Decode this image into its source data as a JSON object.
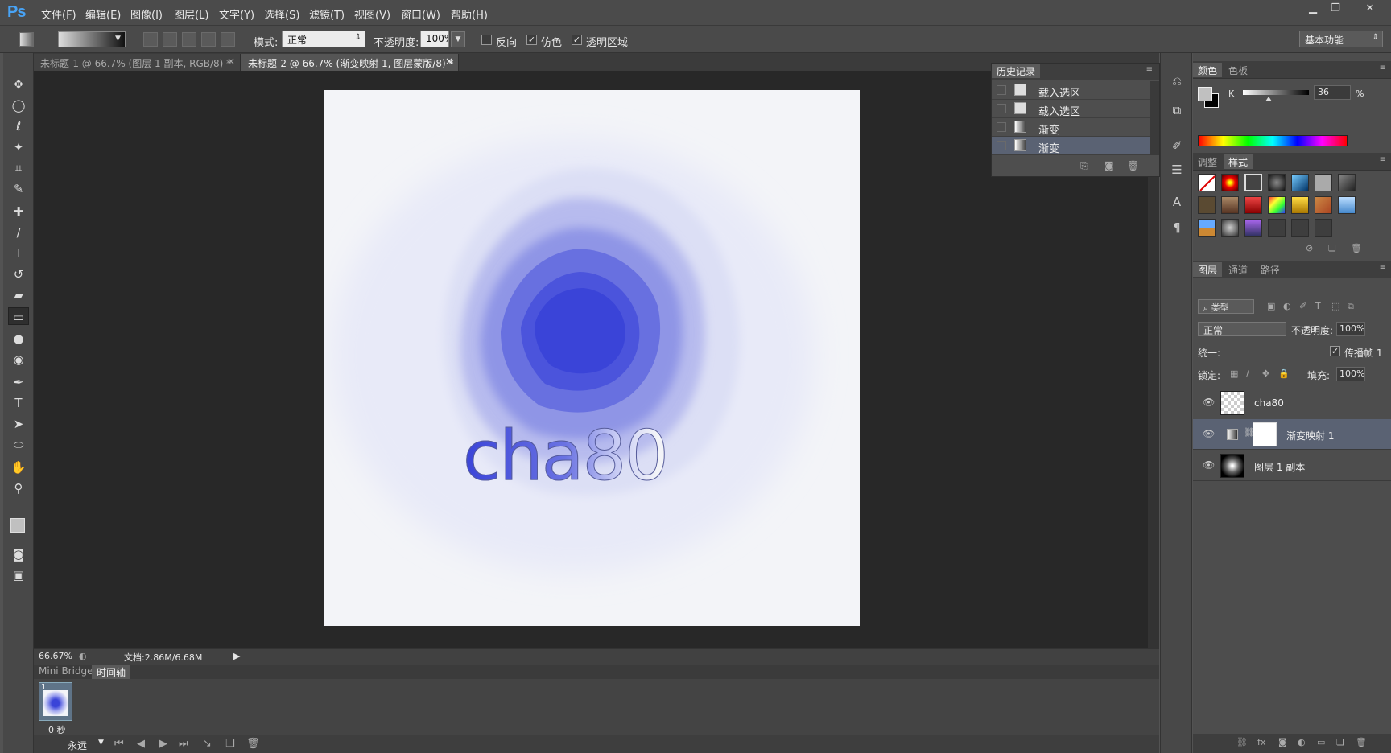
{
  "app": {
    "logo": "Ps"
  },
  "menu": [
    "文件(F)",
    "编辑(E)",
    "图像(I)",
    "图层(L)",
    "文字(Y)",
    "选择(S)",
    "滤镜(T)",
    "视图(V)",
    "窗口(W)",
    "帮助(H)"
  ],
  "window_controls": {
    "minimize": "▁",
    "maximize": "❐",
    "close": "✕"
  },
  "options": {
    "mode_label": "模式:",
    "mode_value": "正常",
    "opacity_label": "不透明度:",
    "opacity_value": "100%",
    "reverse": "反向",
    "dither": "仿色",
    "transparency": "透明区域",
    "workspace": "基本功能"
  },
  "doc_tabs": [
    {
      "title": "未标题-1 @ 66.7% (图层 1 副本, RGB/8) *",
      "close": "×"
    },
    {
      "title": "未标题-2 @ 66.7% (渐变映射 1, 图层蒙版/8) *",
      "close": "×"
    }
  ],
  "canvas": {
    "text": "cha80",
    "blob_color": "#3a44d8"
  },
  "status": {
    "zoom": "66.67%",
    "doc": "文档:2.86M/6.68M"
  },
  "bottom": {
    "tabs": [
      "Mini Bridge",
      "时间轴"
    ],
    "frame_number": "1",
    "frame_delay": "0 秒",
    "loop": "永远"
  },
  "history": {
    "title": "历史记录",
    "items": [
      "载入选区",
      "载入选区",
      "渐变",
      "渐变"
    ]
  },
  "color_panel": {
    "tabs": [
      "颜色",
      "色板"
    ],
    "channel": "K",
    "value": "36",
    "unit": "%"
  },
  "styles_panel": {
    "tabs": [
      "调整",
      "样式"
    ]
  },
  "layers_panel": {
    "tabs": [
      "图层",
      "通道",
      "路径"
    ],
    "filter": "类型",
    "blend": "正常",
    "opacity_label": "不透明度:",
    "opacity": "100%",
    "unify": "统一:",
    "propagate": "传播帧 1",
    "lock": "锁定:",
    "fill_label": "填充:",
    "fill": "100%",
    "layers": [
      "cha80",
      "渐变映射 1",
      "图层 1 副本"
    ]
  }
}
